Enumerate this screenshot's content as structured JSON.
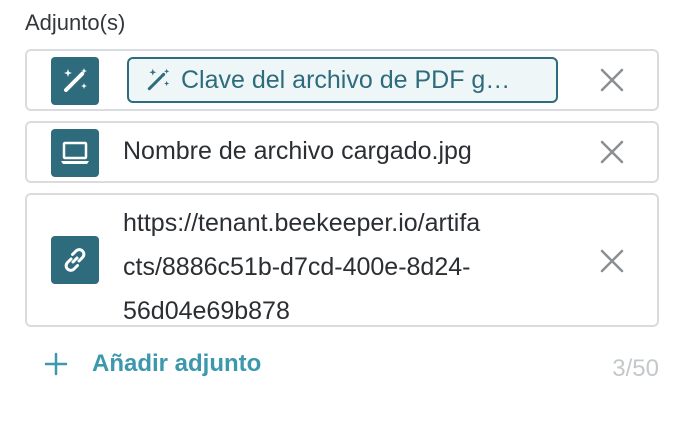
{
  "section": {
    "label": "Adjunto(s)"
  },
  "attachments": [
    {
      "type_icon": "magic-wand-icon",
      "chip_icon": "magic-wand-icon",
      "chip_label": "Clave del archivo de PDF g…"
    },
    {
      "type_icon": "laptop-icon",
      "file_name": "Nombre de archivo cargado.jpg"
    },
    {
      "type_icon": "link-icon",
      "url_lines": [
        "https://tenant.beekeeper.io/artifa",
        "cts/8886c51b-d7cd-400e-8d24-",
        "56d04e69b878"
      ]
    }
  ],
  "footer": {
    "add_label": "Añadir adjunto",
    "counter": "3/50"
  },
  "colors": {
    "icon_bg": "#2e6b7c",
    "accent": "#3b98ad",
    "border": "#d9dcdf",
    "muted": "#c4c8cb"
  }
}
